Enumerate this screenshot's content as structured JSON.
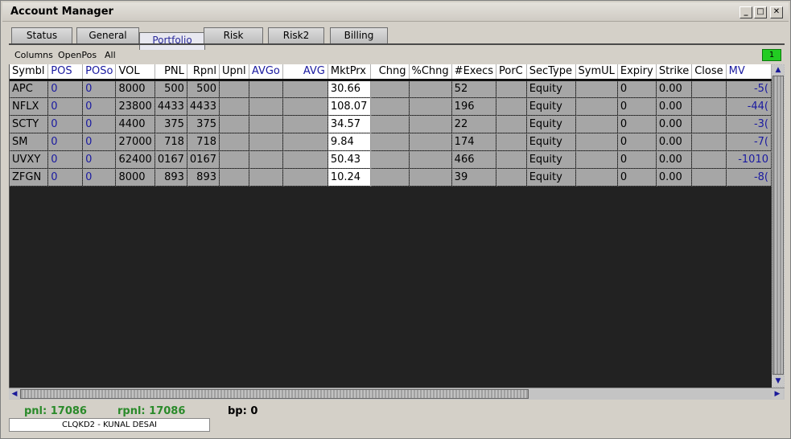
{
  "window": {
    "title": "Account Manager"
  },
  "tabs": [
    {
      "label": "Status"
    },
    {
      "label": "General"
    },
    {
      "label": "Portfolio"
    },
    {
      "label": "Risk"
    },
    {
      "label": "Risk2"
    },
    {
      "label": "Billing"
    }
  ],
  "active_tab": "Portfolio",
  "menu": {
    "columns": "Columns",
    "openpos": "OpenPos",
    "all": "All"
  },
  "badge": "1",
  "table": {
    "headers": [
      "Symbl",
      "POS",
      "POSo",
      "VOL",
      "PNL",
      "Rpnl",
      "Upnl",
      "AVGo",
      "AVG",
      "MktPrx",
      "Chng",
      "%Chng",
      "#Execs",
      "PorC",
      "SecType",
      "SymUL",
      "Expiry",
      "Strike",
      "Close",
      "MV"
    ],
    "rows": [
      [
        "APC",
        "0",
        "0",
        "8000",
        "500",
        "500",
        "",
        "",
        "",
        "30.66",
        "",
        "",
        "52",
        "",
        "Equity",
        "",
        "0",
        "0.00",
        "",
        "-5("
      ],
      [
        "NFLX",
        "0",
        "0",
        "23800",
        "4433",
        "4433",
        "",
        "",
        "",
        "108.07",
        "",
        "",
        "196",
        "",
        "Equity",
        "",
        "0",
        "0.00",
        "",
        "-44("
      ],
      [
        "SCTY",
        "0",
        "0",
        "4400",
        "375",
        "375",
        "",
        "",
        "",
        "34.57",
        "",
        "",
        "22",
        "",
        "Equity",
        "",
        "0",
        "0.00",
        "",
        "-3("
      ],
      [
        "SM",
        "0",
        "0",
        "27000",
        "718",
        "718",
        "",
        "",
        "",
        "9.84",
        "",
        "",
        "174",
        "",
        "Equity",
        "",
        "0",
        "0.00",
        "",
        "-7("
      ],
      [
        "UVXY",
        "0",
        "0",
        "62400",
        "0167",
        "0167",
        "",
        "",
        "",
        "50.43",
        "",
        "",
        "466",
        "",
        "Equity",
        "",
        "0",
        "0.00",
        "",
        "-1010"
      ],
      [
        "ZFGN",
        "0",
        "0",
        "8000",
        "893",
        "893",
        "",
        "",
        "",
        "10.24",
        "",
        "",
        "39",
        "",
        "Equity",
        "",
        "0",
        "0.00",
        "",
        "-8("
      ]
    ]
  },
  "status": {
    "pnl": "pnl: 17086",
    "rpnl": "rpnl: 17086",
    "bp": "bp: 0",
    "account": "CLQKD2 - KUNAL DESAI"
  },
  "colors": {
    "accent_blue": "#1a1aa0",
    "status_green": "#2a8a2a",
    "badge_green": "#22cc22",
    "grid_bg": "#222222",
    "row_bg": "#a6a6a6"
  }
}
